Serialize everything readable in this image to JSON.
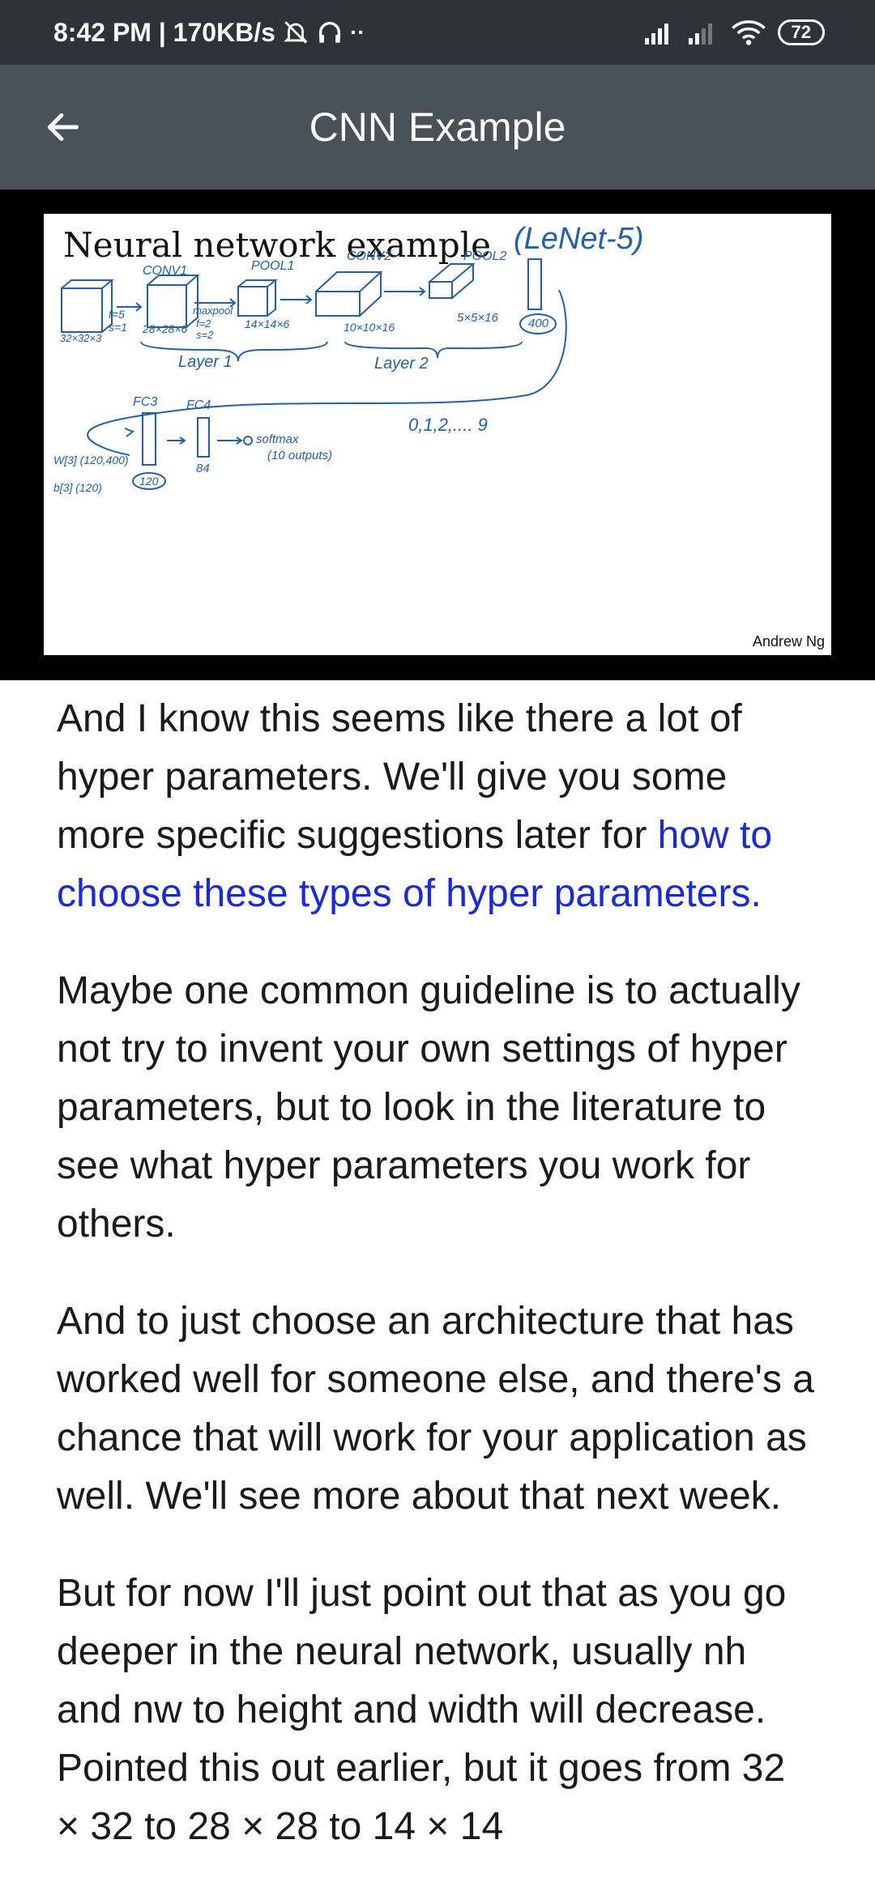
{
  "status_bar": {
    "time_speed": "8:42 PM | 170KB/s",
    "battery": "72"
  },
  "app_bar": {
    "title": "CNN Example"
  },
  "slide": {
    "title": "Neural network example",
    "subtitle": "(LeNet-5)",
    "credit": "Andrew Ng",
    "layers": [
      "CONV1",
      "POOL1",
      "CONV2",
      "POOL2",
      "FC3",
      "FC4"
    ],
    "shapes": [
      "32×32×3",
      "28×28×6",
      "14×14×6",
      "10×10×16",
      "5×5×16",
      "400"
    ],
    "params": [
      "f=5",
      "s=1",
      "maxpool",
      "f=2",
      "s=2"
    ],
    "groups": [
      "Layer 1",
      "Layer 2"
    ],
    "fc_notes": [
      "W[3] (120,400)",
      "b[3] (120)",
      "120",
      "84",
      "softmax",
      "(10 outputs)",
      "0,1,2,.... 9"
    ]
  },
  "article": {
    "p1_text": "And I know this seems like there a lot of hyper parameters. We'll give you some more specific suggestions later for ",
    "p1_link": "how to choose these types of hyper parameters.",
    "p2": "Maybe one common guideline is to actually not try to invent your own settings of hyper parameters, but to look in the literature to see what hyper parameters you work for others.",
    "p3": "And to just choose an architecture that has worked well for someone else, and there's a chance that will work for your application as well. We'll see more about that next week.",
    "p4": "But for now I'll just point out that as you go deeper in the neural network, usually nh and nw to height and width will decrease. Pointed this out earlier, but it goes from 32 × 32 to 28 × 28 to 14 × 14"
  }
}
